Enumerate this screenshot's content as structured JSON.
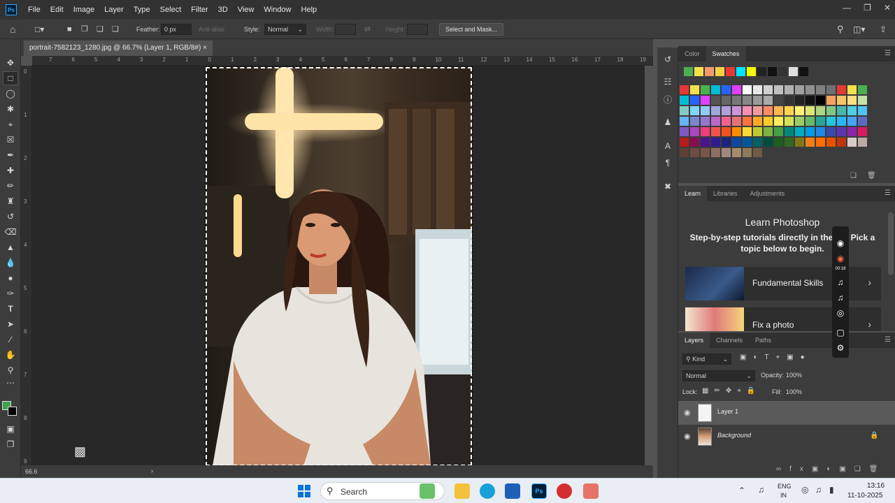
{
  "menubar": {
    "logo": "Ps",
    "items": [
      "File",
      "Edit",
      "Image",
      "Layer",
      "Type",
      "Select",
      "Filter",
      "3D",
      "View",
      "Window",
      "Help"
    ]
  },
  "options": {
    "feather_label": "Feather:",
    "feather_value": "0 px",
    "antialias_label": "Anti-alias",
    "style_label": "Style:",
    "style_value": "Normal",
    "width_label": "Width:",
    "height_label": "Height:",
    "select_mask_label": "Select and Mask..."
  },
  "document": {
    "tab_title": "portrait-7582123_1280.jpg @ 66.7% (Layer 1, RGB/8#)",
    "zoom": "66.6",
    "ruler_top": [
      "7",
      "6",
      "5",
      "4",
      "3",
      "2",
      "1",
      "0",
      "1",
      "2",
      "3",
      "4",
      "5",
      "6",
      "7",
      "8",
      "9",
      "10",
      "11",
      "12",
      "13",
      "14",
      "15",
      "16",
      "17",
      "18",
      "19"
    ],
    "ruler_left": [
      "0",
      "1",
      "2",
      "3",
      "4",
      "5",
      "6",
      "7",
      "8",
      "9"
    ]
  },
  "swatches_panel": {
    "tabs": [
      "Color",
      "Swatches"
    ],
    "active_tab": "Swatches"
  },
  "learn_panel": {
    "tabs": [
      "Learn",
      "Libraries",
      "Adjustments"
    ],
    "active_tab": "Learn",
    "title": "Learn Photoshop",
    "subtitle": "Step-by-step tutorials directly in the a… Pick a topic below to begin.",
    "cards": [
      {
        "label": "Fundamental Skills"
      },
      {
        "label": "Fix a photo"
      }
    ]
  },
  "layers_panel": {
    "tabs": [
      "Layers",
      "Channels",
      "Paths"
    ],
    "active_tab": "Layers",
    "filter_kind": "Kind",
    "blend_mode": "Normal",
    "opacity_label": "Opacity:",
    "opacity_value": "100%",
    "lock_label": "Lock:",
    "fill_label": "Fill:",
    "fill_value": "100%",
    "layers": [
      {
        "name": "Layer 1",
        "selected": true
      },
      {
        "name": "Background",
        "selected": false,
        "locked": true
      }
    ]
  },
  "recorder": {
    "time": "00:18"
  },
  "taskbar": {
    "search_label": "Search",
    "lang_top": "ENG",
    "lang_bottom": "IN",
    "time": "13:16",
    "date": "11-10-2025"
  },
  "colors": {
    "foreground": "#3fa34d",
    "background": "#000000",
    "ps_blue": "#31a8ff"
  }
}
